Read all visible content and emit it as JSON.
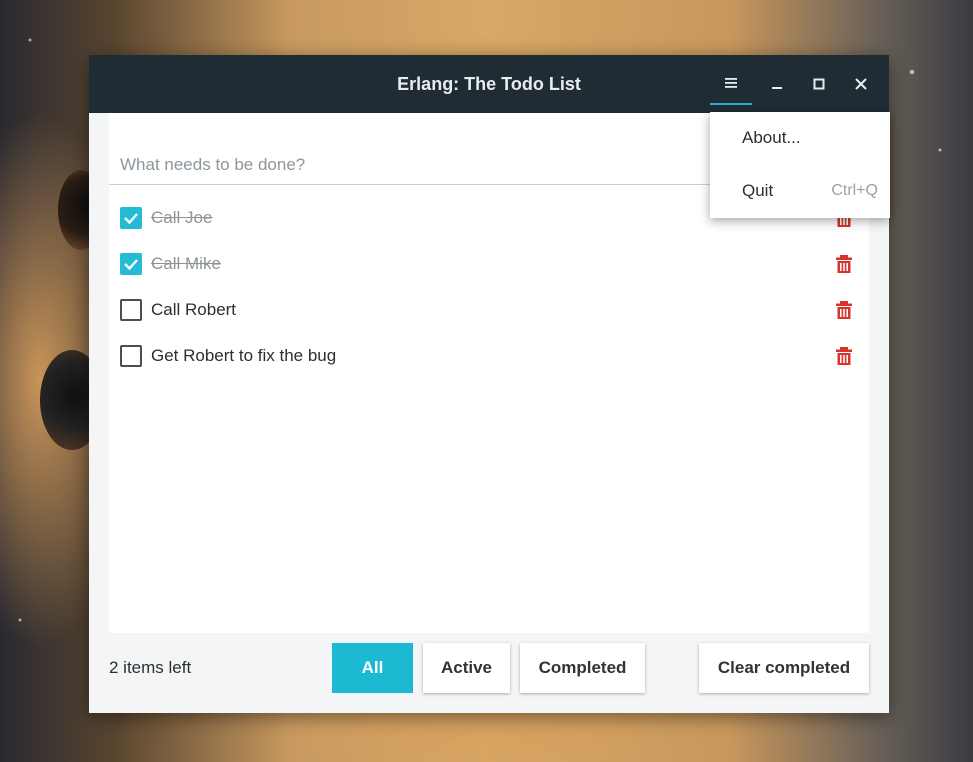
{
  "window": {
    "title": "Erlang: The Todo List"
  },
  "titlebar_icons": {
    "menu": "hamburger-icon",
    "minimize": "minimize-icon",
    "maximize": "maximize-icon",
    "close": "close-icon"
  },
  "new_todo": {
    "placeholder": "What needs to be done?",
    "value": ""
  },
  "todos": [
    {
      "text": "Call Joe",
      "completed": true
    },
    {
      "text": "Call Mike",
      "completed": true
    },
    {
      "text": "Call Robert",
      "completed": false
    },
    {
      "text": "Get Robert to fix the bug",
      "completed": false
    }
  ],
  "footer": {
    "items_left": "2 items left",
    "filters": {
      "all": "All",
      "active": "Active",
      "completed": "Completed"
    },
    "selected_filter": "All",
    "clear_completed": "Clear completed"
  },
  "app_menu": {
    "items": [
      {
        "label": "About...",
        "accelerator": ""
      },
      {
        "label": "Quit",
        "accelerator": "Ctrl+Q"
      }
    ]
  },
  "colors": {
    "titlebar": "#1f2c34",
    "accent": "#1cb9d3",
    "delete": "#d9332f"
  }
}
